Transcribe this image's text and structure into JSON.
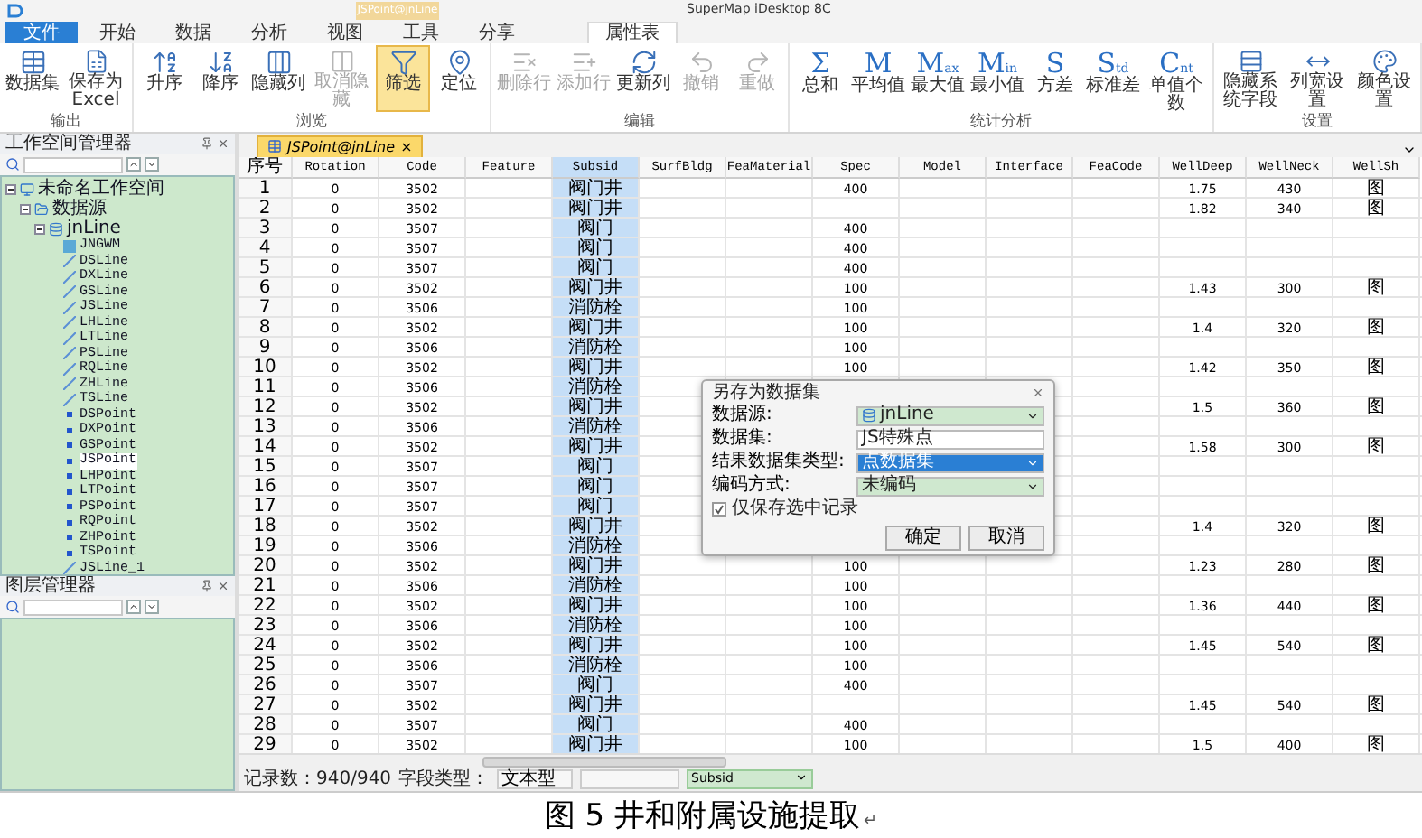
{
  "app": {
    "title": "SuperMap iDesktop 8C",
    "context_tab": "JSPoint@jnLine"
  },
  "ribbon_tabs": [
    {
      "label": "文件",
      "kind": "file",
      "selected": false
    },
    {
      "label": "开始",
      "kind": "tab",
      "selected": false
    },
    {
      "label": "数据",
      "kind": "tab",
      "selected": false
    },
    {
      "label": "分析",
      "kind": "tab",
      "selected": false
    },
    {
      "label": "视图",
      "kind": "tab",
      "selected": false
    },
    {
      "label": "工具",
      "kind": "tab",
      "selected": false
    },
    {
      "label": "分享",
      "kind": "tab",
      "selected": false
    },
    {
      "label": "属性表",
      "kind": "context",
      "selected": true
    }
  ],
  "ribbon_groups": [
    {
      "label": "输出",
      "buttons": [
        {
          "label": "数据集",
          "kind": "table",
          "disabled": false,
          "on": false
        },
        {
          "label": "保存为Excel",
          "kind": "excel",
          "disabled": false,
          "on": false
        }
      ]
    },
    {
      "label": "浏览",
      "buttons": [
        {
          "label": "升序",
          "kind": "sort-asc",
          "disabled": false,
          "on": false
        },
        {
          "label": "降序",
          "kind": "sort-desc",
          "disabled": false,
          "on": false
        },
        {
          "label": "隐藏列",
          "kind": "hide-column",
          "disabled": false,
          "on": false
        },
        {
          "label": "取消隐藏",
          "kind": "show-column",
          "disabled": true,
          "on": false
        },
        {
          "label": "筛选",
          "kind": "filter",
          "disabled": false,
          "on": true
        },
        {
          "label": "定位",
          "kind": "locate",
          "disabled": false,
          "on": false
        }
      ]
    },
    {
      "label": "编辑",
      "buttons": [
        {
          "label": "删除行",
          "kind": "delete-row",
          "disabled": true,
          "on": false
        },
        {
          "label": "添加行",
          "kind": "add-row",
          "disabled": true,
          "on": false
        },
        {
          "label": "更新列",
          "kind": "update-column",
          "disabled": false,
          "on": false
        },
        {
          "label": "撤销",
          "kind": "undo",
          "disabled": true,
          "on": false
        },
        {
          "label": "重做",
          "kind": "redo",
          "disabled": true,
          "on": false
        }
      ]
    },
    {
      "label": "统计分析",
      "buttons": [
        {
          "label": "总和",
          "kind": "glyph",
          "glyph": "Σ",
          "disabled": false,
          "on": false
        },
        {
          "label": "平均值",
          "kind": "glyph",
          "glyph": "M",
          "disabled": false,
          "on": false
        },
        {
          "label": "最大值",
          "kind": "glyph",
          "glyph": "M$_{ax}$",
          "disabled": false,
          "on": false
        },
        {
          "label": "最小值",
          "kind": "glyph",
          "glyph": "M$_{in}$",
          "disabled": false,
          "on": false
        },
        {
          "label": "方差",
          "kind": "glyph",
          "glyph": "S",
          "disabled": false,
          "on": false
        },
        {
          "label": "标准差",
          "kind": "glyph",
          "glyph": "S$_{td}$",
          "disabled": false,
          "on": false
        },
        {
          "label": "单值个数",
          "kind": "glyph",
          "glyph": "C$_{nt}$",
          "disabled": false,
          "on": false
        }
      ]
    },
    {
      "label": "设置",
      "buttons": [
        {
          "label": "隐藏系统字段",
          "kind": "fields",
          "disabled": false,
          "on": false
        },
        {
          "label": "列宽设置",
          "kind": "column-width",
          "disabled": false,
          "on": false
        },
        {
          "label": "颜色设置",
          "kind": "color",
          "disabled": false,
          "on": false
        }
      ]
    }
  ],
  "workspace_manager": {
    "title": "工作空间管理器",
    "tree": [
      {
        "label": "未命名工作空间",
        "kind": "workspace",
        "expanded": true,
        "selected": false,
        "children": [
          {
            "label": "数据源",
            "kind": "datasources",
            "expanded": true,
            "selected": false,
            "children": [
              {
                "label": "jnLine",
                "kind": "datasource",
                "expanded": true,
                "selected": false,
                "children": [
                  {
                    "label": "JNGWM",
                    "kind": "region",
                    "selected": false
                  },
                  {
                    "label": "DSLine",
                    "kind": "line",
                    "selected": false
                  },
                  {
                    "label": "DXLine",
                    "kind": "line",
                    "selected": false
                  },
                  {
                    "label": "GSLine",
                    "kind": "line",
                    "selected": false
                  },
                  {
                    "label": "JSLine",
                    "kind": "line",
                    "selected": false
                  },
                  {
                    "label": "LHLine",
                    "kind": "line",
                    "selected": false
                  },
                  {
                    "label": "LTLine",
                    "kind": "line",
                    "selected": false
                  },
                  {
                    "label": "PSLine",
                    "kind": "line",
                    "selected": false
                  },
                  {
                    "label": "RQLine",
                    "kind": "line",
                    "selected": false
                  },
                  {
                    "label": "ZHLine",
                    "kind": "line",
                    "selected": false
                  },
                  {
                    "label": "TSLine",
                    "kind": "line",
                    "selected": false
                  },
                  {
                    "label": "DSPoint",
                    "kind": "point",
                    "selected": false
                  },
                  {
                    "label": "DXPoint",
                    "kind": "point",
                    "selected": false
                  },
                  {
                    "label": "GSPoint",
                    "kind": "point",
                    "selected": false
                  },
                  {
                    "label": "JSPoint",
                    "kind": "point",
                    "selected": true
                  },
                  {
                    "label": "LHPoint",
                    "kind": "point",
                    "selected": false
                  },
                  {
                    "label": "LTPoint",
                    "kind": "point",
                    "selected": false
                  },
                  {
                    "label": "PSPoint",
                    "kind": "point",
                    "selected": false
                  },
                  {
                    "label": "RQPoint",
                    "kind": "point",
                    "selected": false
                  },
                  {
                    "label": "ZHPoint",
                    "kind": "point",
                    "selected": false
                  },
                  {
                    "label": "TSPoint",
                    "kind": "point",
                    "selected": false
                  },
                  {
                    "label": "JSLine_1",
                    "kind": "line",
                    "selected": false
                  }
                ]
              }
            ]
          }
        ]
      }
    ]
  },
  "layer_manager": {
    "title": "图层管理器"
  },
  "document_tab": {
    "label": "JSPoint@jnLine",
    "close": "×"
  },
  "table": {
    "columns": [
      {
        "label": "序号",
        "selected": false
      },
      {
        "label": "Rotation",
        "selected": false
      },
      {
        "label": "Code",
        "selected": false
      },
      {
        "label": "Feature",
        "selected": false
      },
      {
        "label": "Subsid",
        "selected": true
      },
      {
        "label": "SurfBldg",
        "selected": false
      },
      {
        "label": "FeaMaterial",
        "selected": false
      },
      {
        "label": "Spec",
        "selected": false
      },
      {
        "label": "Model",
        "selected": false
      },
      {
        "label": "Interface",
        "selected": false
      },
      {
        "label": "FeaCode",
        "selected": false
      },
      {
        "label": "WellDeep",
        "selected": false
      },
      {
        "label": "WellNeck",
        "selected": false
      },
      {
        "label": "WellSh",
        "selected": false
      }
    ],
    "rows": [
      [
        "1",
        "0",
        "3502",
        null,
        "阀门井",
        null,
        null,
        "400",
        null,
        null,
        null,
        "1.75",
        "430",
        "图"
      ],
      [
        "2",
        "0",
        "3502",
        null,
        "阀门井",
        null,
        null,
        null,
        null,
        null,
        null,
        "1.82",
        "340",
        "图"
      ],
      [
        "3",
        "0",
        "3507",
        null,
        "阀门",
        null,
        null,
        "400",
        null,
        null,
        null,
        null,
        null,
        null
      ],
      [
        "4",
        "0",
        "3507",
        null,
        "阀门",
        null,
        null,
        "400",
        null,
        null,
        null,
        null,
        null,
        null
      ],
      [
        "5",
        "0",
        "3507",
        null,
        "阀门",
        null,
        null,
        "400",
        null,
        null,
        null,
        null,
        null,
        null
      ],
      [
        "6",
        "0",
        "3502",
        null,
        "阀门井",
        null,
        null,
        "100",
        null,
        null,
        null,
        "1.43",
        "300",
        "图"
      ],
      [
        "7",
        "0",
        "3506",
        null,
        "消防栓",
        null,
        null,
        "100",
        null,
        null,
        null,
        null,
        null,
        null
      ],
      [
        "8",
        "0",
        "3502",
        null,
        "阀门井",
        null,
        null,
        "100",
        null,
        null,
        null,
        "1.4",
        "320",
        "图"
      ],
      [
        "9",
        "0",
        "3506",
        null,
        "消防栓",
        null,
        null,
        "100",
        null,
        null,
        null,
        null,
        null,
        null
      ],
      [
        "10",
        "0",
        "3502",
        null,
        "阀门井",
        null,
        null,
        "100",
        null,
        null,
        null,
        "1.42",
        "350",
        "图"
      ],
      [
        "11",
        "0",
        "3506",
        null,
        "消防栓",
        null,
        null,
        null,
        null,
        null,
        null,
        null,
        null,
        null
      ],
      [
        "12",
        "0",
        "3502",
        null,
        "阀门井",
        null,
        null,
        null,
        null,
        null,
        null,
        "1.5",
        "360",
        "图"
      ],
      [
        "13",
        "0",
        "3506",
        null,
        "消防栓",
        null,
        null,
        null,
        null,
        null,
        null,
        null,
        null,
        null
      ],
      [
        "14",
        "0",
        "3502",
        null,
        "阀门井",
        null,
        null,
        null,
        null,
        null,
        null,
        "1.58",
        "300",
        "图"
      ],
      [
        "15",
        "0",
        "3507",
        null,
        "阀门",
        null,
        null,
        null,
        null,
        null,
        null,
        null,
        null,
        null
      ],
      [
        "16",
        "0",
        "3507",
        null,
        "阀门",
        null,
        null,
        null,
        null,
        null,
        null,
        null,
        null,
        null
      ],
      [
        "17",
        "0",
        "3507",
        null,
        "阀门",
        null,
        null,
        null,
        null,
        null,
        null,
        null,
        null,
        null
      ],
      [
        "18",
        "0",
        "3502",
        null,
        "阀门井",
        null,
        null,
        null,
        null,
        null,
        null,
        "1.4",
        "320",
        "图"
      ],
      [
        "19",
        "0",
        "3506",
        null,
        "消防栓",
        null,
        null,
        null,
        null,
        null,
        null,
        null,
        null,
        null
      ],
      [
        "20",
        "0",
        "3502",
        null,
        "阀门井",
        null,
        null,
        "100",
        null,
        null,
        null,
        "1.23",
        "280",
        "图"
      ],
      [
        "21",
        "0",
        "3506",
        null,
        "消防栓",
        null,
        null,
        "100",
        null,
        null,
        null,
        null,
        null,
        null
      ],
      [
        "22",
        "0",
        "3502",
        null,
        "阀门井",
        null,
        null,
        "100",
        null,
        null,
        null,
        "1.36",
        "440",
        "图"
      ],
      [
        "23",
        "0",
        "3506",
        null,
        "消防栓",
        null,
        null,
        "100",
        null,
        null,
        null,
        null,
        null,
        null
      ],
      [
        "24",
        "0",
        "3502",
        null,
        "阀门井",
        null,
        null,
        "100",
        null,
        null,
        null,
        "1.45",
        "540",
        "图"
      ],
      [
        "25",
        "0",
        "3506",
        null,
        "消防栓",
        null,
        null,
        "100",
        null,
        null,
        null,
        null,
        null,
        null
      ],
      [
        "26",
        "0",
        "3507",
        null,
        "阀门",
        null,
        null,
        "400",
        null,
        null,
        null,
        null,
        null,
        null
      ],
      [
        "27",
        "0",
        "3502",
        null,
        "阀门井",
        null,
        null,
        null,
        null,
        null,
        null,
        "1.45",
        "540",
        "图"
      ],
      [
        "28",
        "0",
        "3507",
        null,
        "阀门",
        null,
        null,
        "400",
        null,
        null,
        null,
        null,
        null,
        null
      ],
      [
        "29",
        "0",
        "3502",
        null,
        "阀门井",
        null,
        null,
        "100",
        null,
        null,
        null,
        "1.5",
        "400",
        "图"
      ]
    ]
  },
  "dialog": {
    "title": "另存为数据集",
    "fields": [
      {
        "label": "数据源:",
        "kind": "datasource-select",
        "value": "jnLine",
        "focused": false
      },
      {
        "label": "数据集:",
        "kind": "input",
        "value": "JS特殊点",
        "focused": false
      },
      {
        "label": "结果数据集类型:",
        "kind": "select",
        "value": "点数据集",
        "focused": true
      },
      {
        "label": "编码方式:",
        "kind": "select",
        "value": "未编码",
        "focused": false
      }
    ],
    "checkbox": {
      "label": "仅保存选中记录",
      "checked": true
    },
    "buttons": [
      "确定",
      "取消"
    ]
  },
  "status_bar": {
    "record_count": "记录数：940/940",
    "field_type_label": "字段类型：",
    "field_type": "文本型",
    "field": "Subsid"
  },
  "caption": {
    "text": "图 5 井和附属设施提取",
    "mark": "↵"
  }
}
